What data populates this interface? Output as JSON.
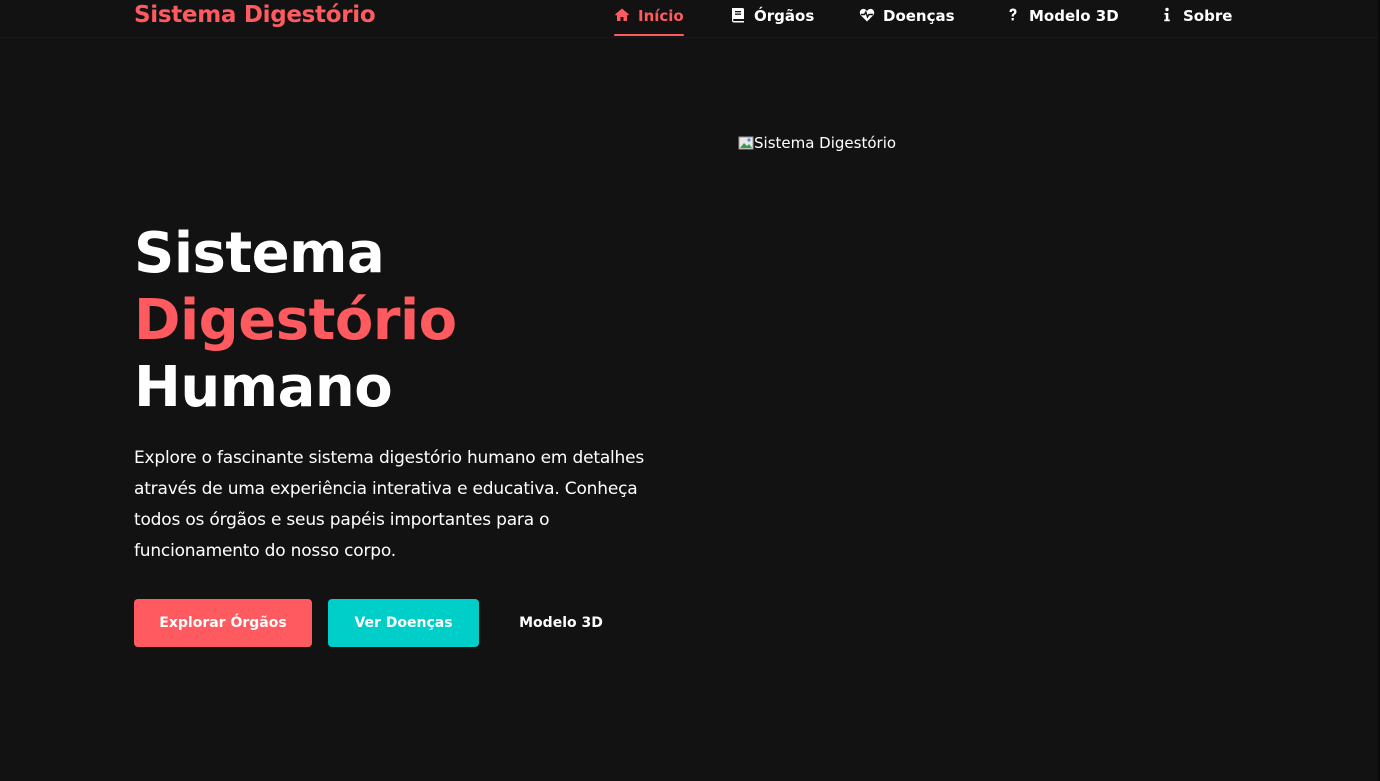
{
  "brand": "Sistema Digestório",
  "nav": {
    "items": [
      {
        "label": "Início",
        "icon": "home-icon",
        "active": true
      },
      {
        "label": "Órgãos",
        "icon": "book-icon",
        "active": false
      },
      {
        "label": "Doenças",
        "icon": "heartbeat-icon",
        "active": false
      },
      {
        "label": "Modelo 3D",
        "icon": "question-icon",
        "active": false
      },
      {
        "label": "Sobre",
        "icon": "info-icon",
        "active": false
      }
    ]
  },
  "hero": {
    "title_line1": "Sistema",
    "title_line2": "Digestório",
    "title_line3": "Humano",
    "description": "Explore o fascinante sistema digestório humano em detalhes através de uma experiência interativa e educativa. Conheça todos os órgãos e seus papéis importantes para o funcionamento do nosso corpo.",
    "buttons": {
      "primary": "Explorar Órgãos",
      "secondary": "Ver Doenças",
      "tertiary": "Modelo 3D"
    },
    "image_alt": "Sistema Digestório"
  },
  "colors": {
    "background": "#121212",
    "accent": "#ff5a5f",
    "teal": "#00cec9",
    "text": "#ffffff"
  }
}
